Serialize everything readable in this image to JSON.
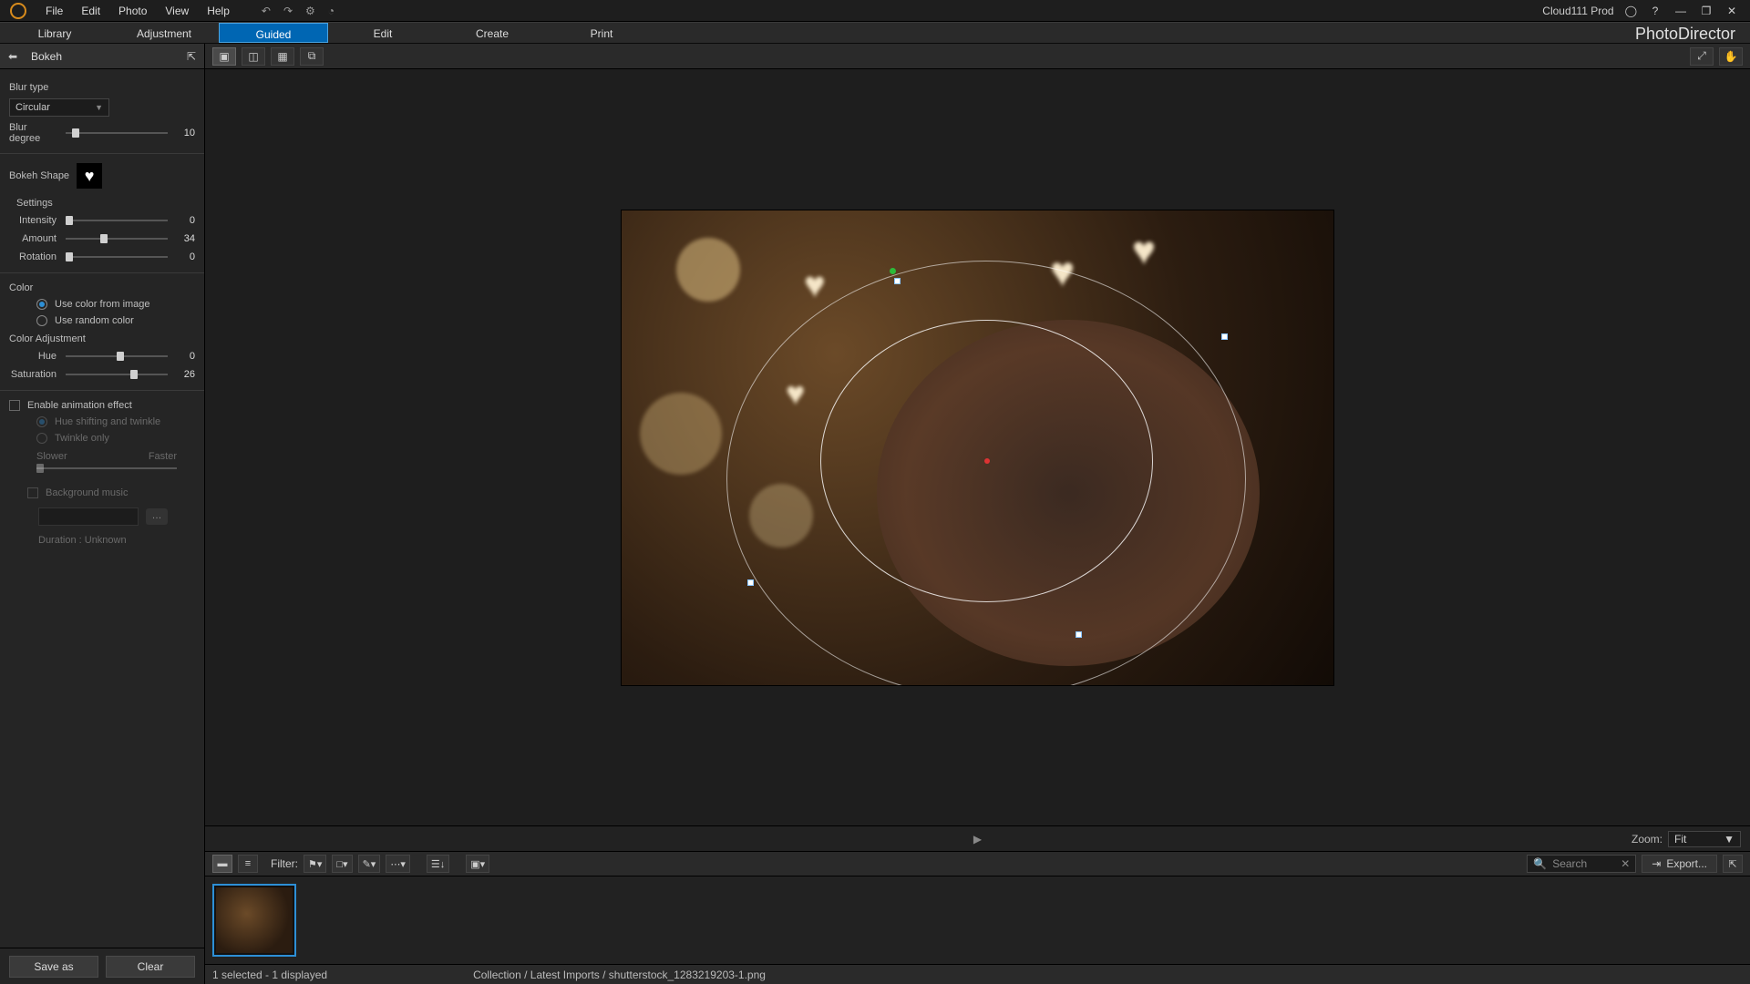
{
  "app": {
    "brand": "PhotoDirector",
    "user": "Cloud111 Prod"
  },
  "menubar": {
    "items": [
      "File",
      "Edit",
      "Photo",
      "View",
      "Help"
    ]
  },
  "tabs": {
    "items": [
      "Library",
      "Adjustment",
      "Guided",
      "Edit",
      "Create",
      "Print"
    ],
    "active": 2
  },
  "viewToolbar": {
    "zoomTool": "⤢",
    "panTool": "✋"
  },
  "panel": {
    "title": "Bokeh",
    "blurTypeLabel": "Blur type",
    "blurType": "Circular",
    "blurDegreeLabel": "Blur degree",
    "blurDegree": 10,
    "bokehShapeLabel": "Bokeh Shape",
    "settingsLabel": "Settings",
    "intensity": {
      "label": "Intensity",
      "value": 0,
      "pct": 0
    },
    "amount": {
      "label": "Amount",
      "value": 34,
      "pct": 34
    },
    "rotation": {
      "label": "Rotation",
      "value": 0,
      "pct": 0
    },
    "colorLabel": "Color",
    "colorOpt1": "Use color from image",
    "colorOpt2": "Use random color",
    "colorAdjLabel": "Color Adjustment",
    "hue": {
      "label": "Hue",
      "value": 0,
      "pct": 50
    },
    "saturation": {
      "label": "Saturation",
      "value": 26,
      "pct": 63
    },
    "animEnable": "Enable animation effect",
    "animOpt1": "Hue shifting and twinkle",
    "animOpt2": "Twinkle only",
    "slower": "Slower",
    "faster": "Faster",
    "bgMusic": "Background music",
    "duration": "Duration : Unknown",
    "saveAs": "Save as",
    "clear": "Clear"
  },
  "playRow": {
    "zoomLabel": "Zoom:",
    "zoomValue": "Fit"
  },
  "filterBar": {
    "filterLabel": "Filter:",
    "searchPlaceholder": "Search",
    "exportLabel": "Export..."
  },
  "status": {
    "selection": "1 selected - 1 displayed",
    "path": "Collection / Latest Imports / shutterstock_1283219203-1.png"
  }
}
